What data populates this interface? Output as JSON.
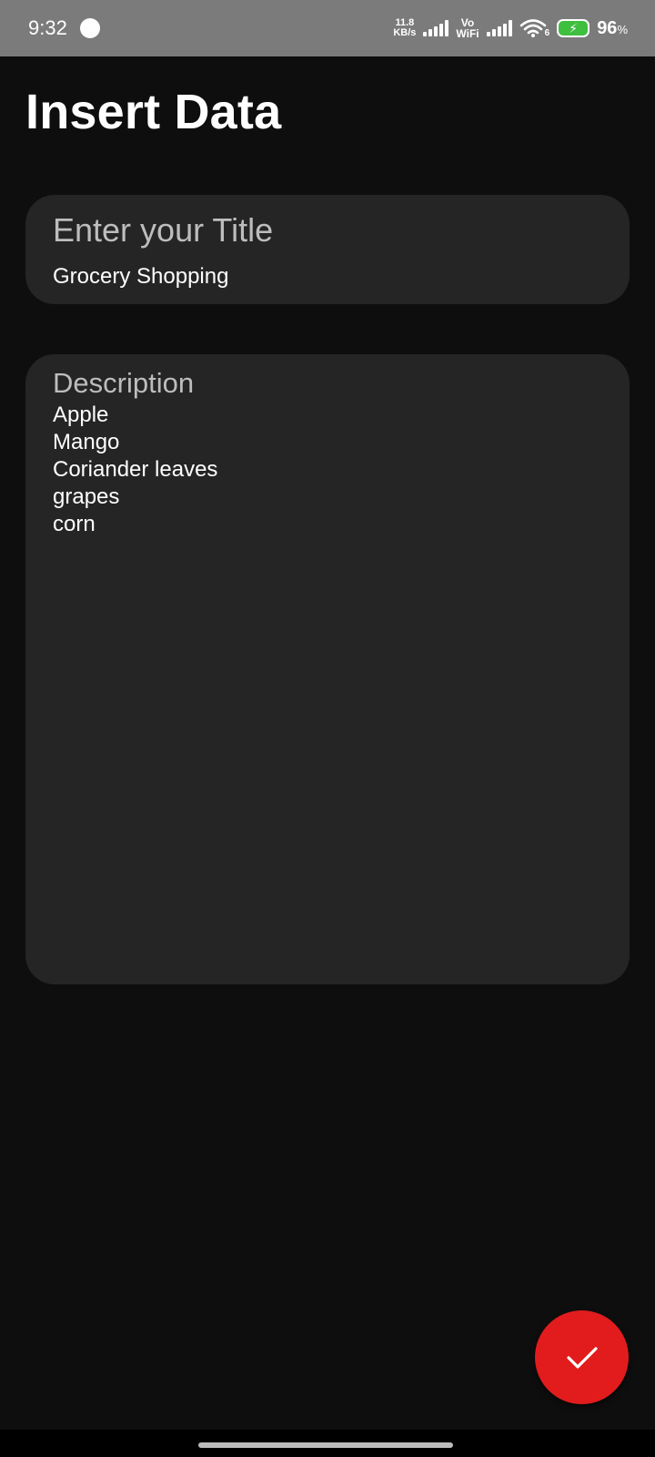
{
  "status_bar": {
    "time": "9:32",
    "net_speed_value": "11.8",
    "net_speed_unit": "KB/s",
    "vowifi_top": "Vo",
    "vowifi_bottom": "WiFi",
    "wifi_badge": "6",
    "battery_percent": "96",
    "battery_percent_sign": "%"
  },
  "page": {
    "title": "Insert Data"
  },
  "title_field": {
    "label": "Enter your Title",
    "value": "Grocery Shopping"
  },
  "description_field": {
    "label": "Description",
    "lines": [
      "Apple",
      "Mango",
      "Coriander leaves",
      "grapes",
      "corn"
    ]
  },
  "fab": {
    "icon": "check-icon",
    "color": "#e21c1c"
  },
  "colors": {
    "background": "#0e0e0e",
    "field_background": "#252525",
    "status_bar": "#7b7b7b",
    "accent": "#e21c1c"
  }
}
